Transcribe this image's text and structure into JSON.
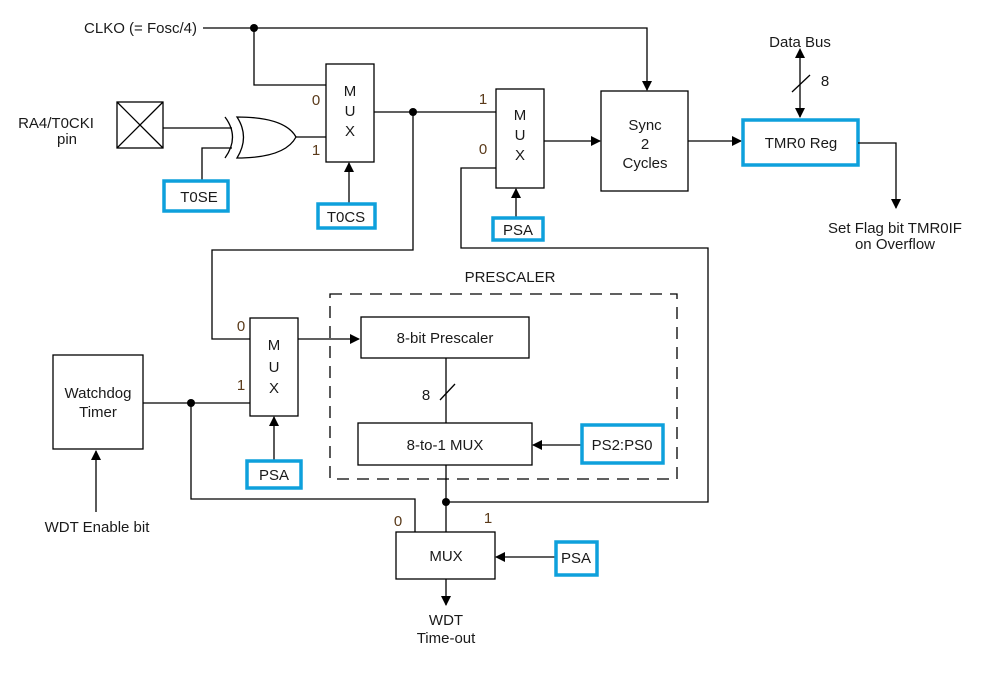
{
  "signals": {
    "clko": "CLKO (= Fosc/4)",
    "pin_line1": "RA4/T0CKI",
    "pin_line2": "pin",
    "data_bus": "Data Bus",
    "data_bus_width": "8",
    "flag_line1": "Set Flag bit TMR0IF",
    "flag_line2": "on Overflow",
    "wdt_enable": "WDT Enable bit",
    "wdt_out_line1": "WDT",
    "wdt_out_line2": "Time-out",
    "prescaler_width": "8"
  },
  "blocks": {
    "mux_letters": [
      "M",
      "U",
      "X"
    ],
    "sync_lines": [
      "Sync",
      "2",
      "Cycles"
    ],
    "tmr0": "TMR0 Reg",
    "watchdog_lines": [
      "Watchdog",
      "Timer"
    ],
    "prescaler_title": "PRESCALER",
    "prescaler8": "8-bit Prescaler",
    "mux8to1": "8-to-1 MUX",
    "wdt_mux": "MUX"
  },
  "bits": {
    "t0se": "T0SE",
    "t0cs": "T0CS",
    "psa": "PSA",
    "ps": "PS2:PS0"
  },
  "mux_inputs": {
    "zero": "0",
    "one": "1"
  },
  "colors": {
    "config_bit_border": "#0ea0dc"
  }
}
